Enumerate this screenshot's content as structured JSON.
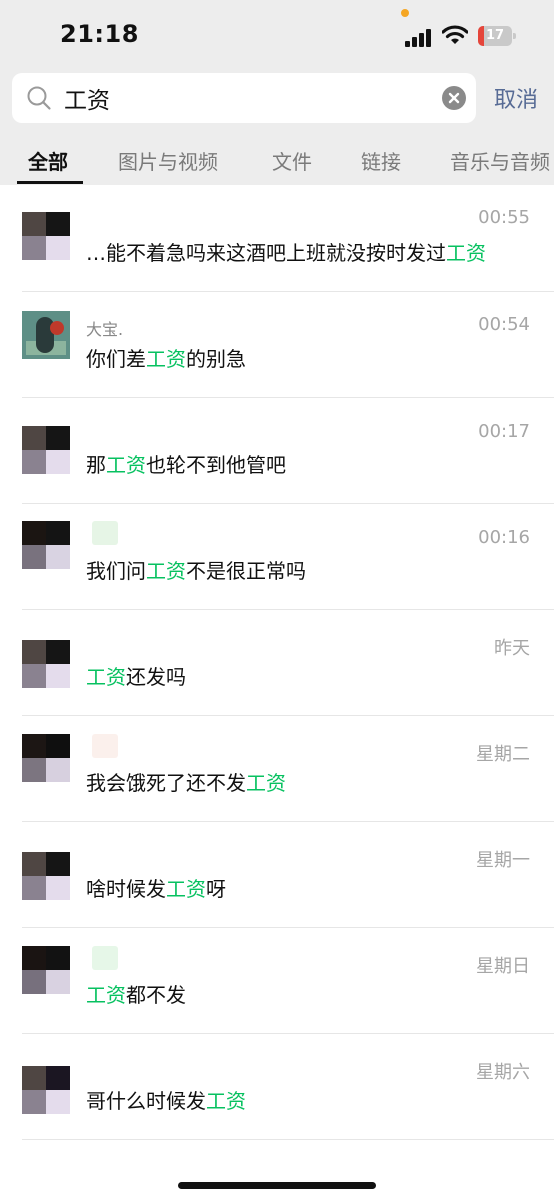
{
  "status_bar": {
    "time": "21:18",
    "battery": "17",
    "battery_level": 0.17
  },
  "search": {
    "value": "工资",
    "cancel_label": "取消"
  },
  "tabs": [
    {
      "label": "全部",
      "active": true
    },
    {
      "label": "图片与视频",
      "active": false
    },
    {
      "label": "文件",
      "active": false
    },
    {
      "label": "链接",
      "active": false
    },
    {
      "label": "音乐与音频",
      "active": false
    }
  ],
  "results": [
    {
      "sender": "",
      "time": "00:55",
      "msg_before": "…能不着急吗来这酒吧上班就没按时发过",
      "keyword": "工资",
      "msg_after": ""
    },
    {
      "sender": "大宝.",
      "time": "00:54",
      "msg_before": "你们差",
      "keyword": "工资",
      "msg_after": "的别急"
    },
    {
      "sender": "",
      "time": "00:17",
      "msg_before": "那",
      "keyword": "工资",
      "msg_after": "也轮不到他管吧"
    },
    {
      "sender": "",
      "time": "00:16",
      "msg_before": "我们问",
      "keyword": "工资",
      "msg_after": "不是很正常吗"
    },
    {
      "sender": "",
      "time": "昨天",
      "msg_before": "",
      "keyword": "工资",
      "msg_after": "还发吗"
    },
    {
      "sender": "",
      "time": "星期二",
      "msg_before": "我会饿死了还不发",
      "keyword": "工资",
      "msg_after": ""
    },
    {
      "sender": "",
      "time": "星期一",
      "msg_before": "啥时候发",
      "keyword": "工资",
      "msg_after": "呀"
    },
    {
      "sender": "",
      "time": "星期日",
      "msg_before": "",
      "keyword": "工资",
      "msg_after": "都不发"
    },
    {
      "sender": "",
      "time": "星期六",
      "msg_before": "哥什么时候发",
      "keyword": "工资",
      "msg_after": ""
    }
  ],
  "colors": {
    "highlight": "#07c160",
    "cancel": "#576b95",
    "battery_low": "#e5453a"
  }
}
